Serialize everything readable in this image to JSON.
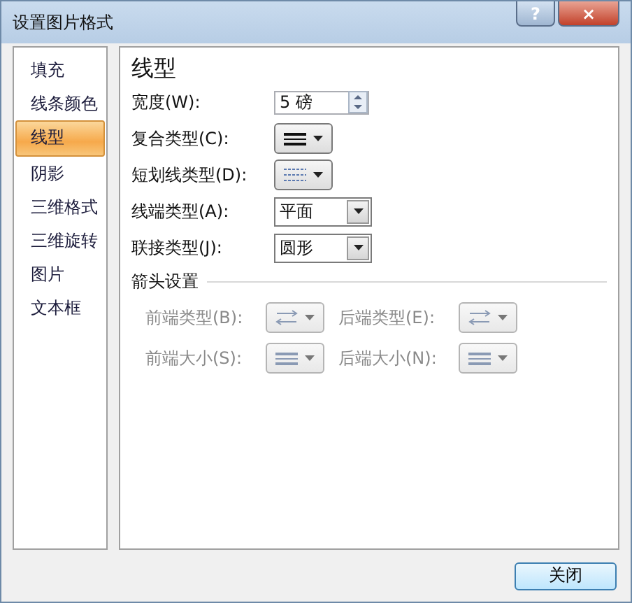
{
  "window": {
    "title": "设置图片格式",
    "buttons": [
      "?",
      "×"
    ]
  },
  "sidebar": {
    "items": [
      {
        "label": "填充",
        "selected": false
      },
      {
        "label": "线条颜色",
        "selected": false
      },
      {
        "label": "线型",
        "selected": true
      },
      {
        "label": "阴影",
        "selected": false
      },
      {
        "label": "三维格式",
        "selected": false
      },
      {
        "label": "三维旋转",
        "selected": false
      },
      {
        "label": "图片",
        "selected": false
      },
      {
        "label": "文本框",
        "selected": false
      }
    ]
  },
  "panel": {
    "heading": "线型",
    "fields": [
      {
        "label": "宽度(W):",
        "kind": "spin",
        "value": "5 磅"
      },
      {
        "label": "复合类型(C):",
        "kind": "compound"
      },
      {
        "label": "短划线类型(D):",
        "kind": "dash"
      },
      {
        "label": "线端类型(A):",
        "kind": "combo",
        "value": "平面"
      },
      {
        "label": "联接类型(J):",
        "kind": "combo",
        "value": "圆形"
      }
    ],
    "arrow_section": {
      "title": "箭头设置",
      "fields": [
        {
          "label": "前端类型(B):",
          "kind": "arrow",
          "disabled": true
        },
        {
          "label": "后端类型(E):",
          "kind": "arrow",
          "disabled": true
        },
        {
          "label": "前端大小(S):",
          "kind": "size",
          "disabled": true
        },
        {
          "label": "后端大小(N):",
          "kind": "size",
          "disabled": true
        }
      ]
    }
  },
  "footer": {
    "close_button": "关闭"
  }
}
